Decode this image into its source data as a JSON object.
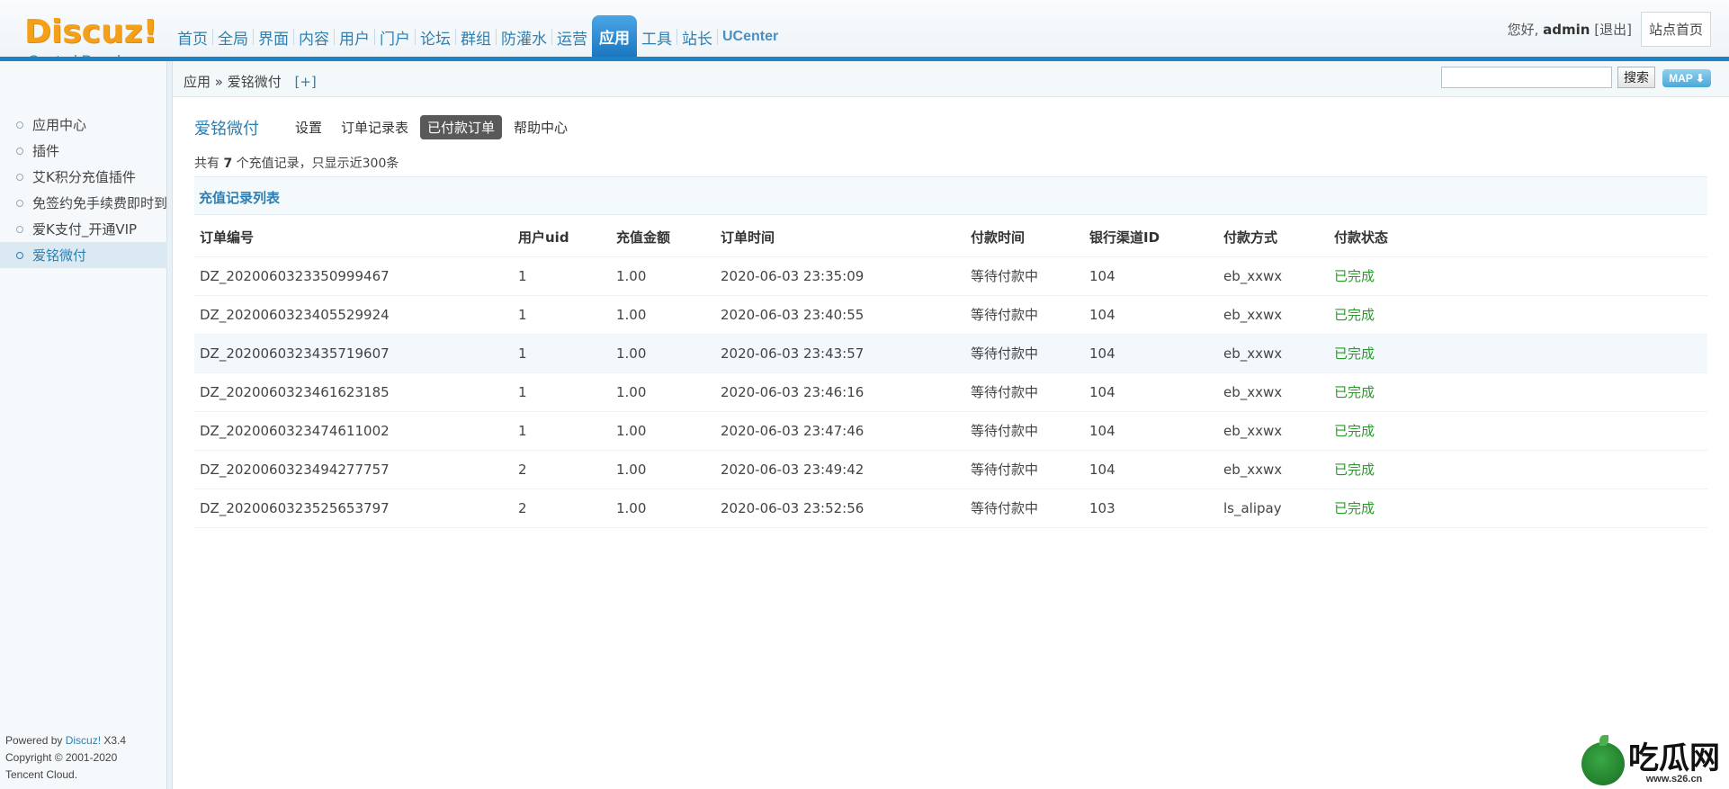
{
  "logo": {
    "word": "Discuz!",
    "subtitle": "Control Panel"
  },
  "nav": {
    "items": [
      {
        "label": "首页"
      },
      {
        "label": "全局"
      },
      {
        "label": "界面"
      },
      {
        "label": "内容"
      },
      {
        "label": "用户"
      },
      {
        "label": "门户"
      },
      {
        "label": "论坛"
      },
      {
        "label": "群组"
      },
      {
        "label": "防灌水"
      },
      {
        "label": "运营"
      },
      {
        "label": "应用",
        "active": true
      },
      {
        "label": "工具"
      },
      {
        "label": "站长"
      },
      {
        "label": "UCenter"
      }
    ]
  },
  "user": {
    "greeting": "您好,",
    "name": "admin",
    "logout": "[退出]",
    "site_home": "站点首页"
  },
  "subbar": {
    "breadcrumb": "应用 » 爱铭微付",
    "add": "[+]",
    "search_value": "",
    "search_button": "搜索",
    "map_button": "MAP ⬇"
  },
  "sidebar": {
    "items": [
      {
        "label": "应用中心"
      },
      {
        "label": "插件"
      },
      {
        "label": "艾K积分充值插件"
      },
      {
        "label": "免签约免手续费即时到帐"
      },
      {
        "label": "爱K支付_开通VIP"
      },
      {
        "label": "爱铭微付",
        "active": true
      }
    ],
    "powered_prefix": "Powered by ",
    "powered_brand": "Discuz!",
    "powered_version": " X3.4",
    "copyright": "Copyright © 2001-2020",
    "company": "Tencent Cloud."
  },
  "main": {
    "plugin_title": "爱铭微付",
    "tabs": [
      {
        "label": "设置"
      },
      {
        "label": "订单记录表"
      },
      {
        "label": "已付款订单",
        "active": true
      },
      {
        "label": "帮助中心"
      }
    ],
    "count_prefix": "共有 ",
    "count": "7",
    "count_suffix": " 个充值记录，只显示近300条",
    "list_title": "充值记录列表",
    "columns": [
      "订单编号",
      "用户uid",
      "充值金额",
      "订单时间",
      "付款时间",
      "银行渠道ID",
      "付款方式",
      "付款状态"
    ],
    "rows": [
      [
        "DZ_2020060323350999467",
        "1",
        "1.00",
        "2020-06-03 23:35:09",
        "等待付款中",
        "104",
        "eb_xxwx",
        "已完成"
      ],
      [
        "DZ_2020060323405529924",
        "1",
        "1.00",
        "2020-06-03 23:40:55",
        "等待付款中",
        "104",
        "eb_xxwx",
        "已完成"
      ],
      [
        "DZ_2020060323435719607",
        "1",
        "1.00",
        "2020-06-03 23:43:57",
        "等待付款中",
        "104",
        "eb_xxwx",
        "已完成"
      ],
      [
        "DZ_2020060323461623185",
        "1",
        "1.00",
        "2020-06-03 23:46:16",
        "等待付款中",
        "104",
        "eb_xxwx",
        "已完成"
      ],
      [
        "DZ_2020060323474611002",
        "1",
        "1.00",
        "2020-06-03 23:47:46",
        "等待付款中",
        "104",
        "eb_xxwx",
        "已完成"
      ],
      [
        "DZ_2020060323494277757",
        "2",
        "1.00",
        "2020-06-03 23:49:42",
        "等待付款中",
        "104",
        "eb_xxwx",
        "已完成"
      ],
      [
        "DZ_2020060323525653797",
        "2",
        "1.00",
        "2020-06-03 23:52:56",
        "等待付款中",
        "103",
        "ls_alipay",
        "已完成"
      ]
    ]
  },
  "watermark": {
    "text": "吃瓜网",
    "url": "www.s26.cn"
  },
  "colors": {
    "accent": "#1c84c6",
    "logo": "#f4a01a",
    "link": "#2f7fb0",
    "success": "#2a9a2a"
  }
}
